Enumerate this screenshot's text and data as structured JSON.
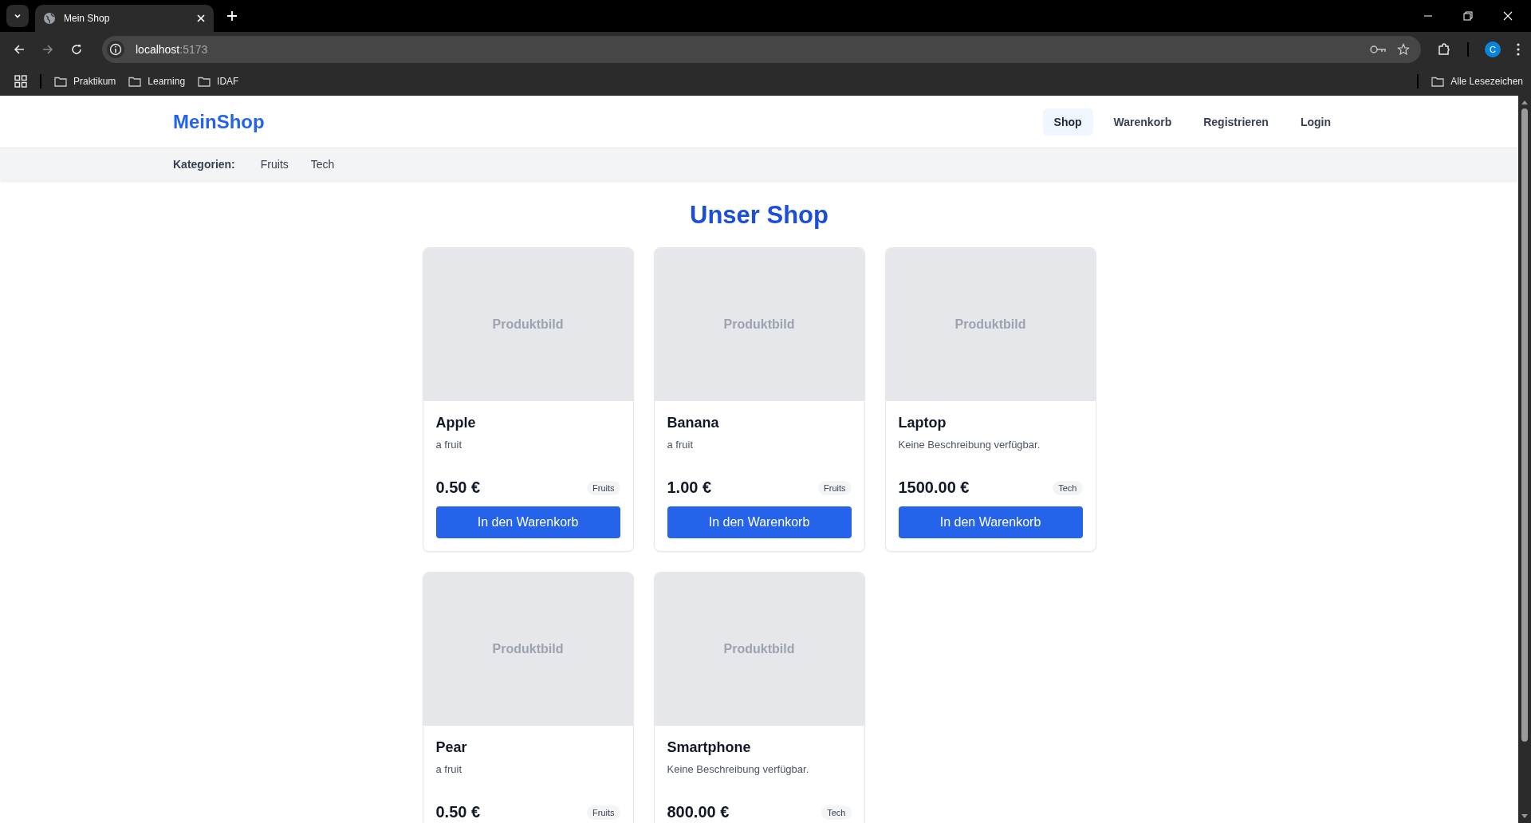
{
  "browser": {
    "tabs": [
      {
        "title": "Mein Shop",
        "selected": true
      }
    ],
    "address": {
      "host": "localhost",
      "port": ":5173"
    },
    "bookmarks": [
      "Praktikum",
      "Learning",
      "IDAF"
    ],
    "all_bookmarks": "Alle Lesezeichen",
    "profile_initial": "C"
  },
  "header": {
    "logo": "MeinShop",
    "nav": [
      {
        "label": "Shop",
        "selected": true
      },
      {
        "label": "Warenkorb",
        "selected": false
      },
      {
        "label": "Registrieren",
        "selected": false
      },
      {
        "label": "Login",
        "selected": false
      }
    ]
  },
  "categories": {
    "label": "Kategorien:",
    "items": [
      "Fruits",
      "Tech"
    ]
  },
  "heading": "Unser Shop",
  "products": [
    {
      "image_placeholder": "Produktbild",
      "name": "Apple",
      "description": "a fruit",
      "price": "0.50 €",
      "category": "Fruits",
      "button": "In den Warenkorb"
    },
    {
      "image_placeholder": "Produktbild",
      "name": "Banana",
      "description": "a fruit",
      "price": "1.00 €",
      "category": "Fruits",
      "button": "In den Warenkorb"
    },
    {
      "image_placeholder": "Produktbild",
      "name": "Laptop",
      "description": "Keine Beschreibung verfügbar.",
      "price": "1500.00 €",
      "category": "Tech",
      "button": "In den Warenkorb"
    },
    {
      "image_placeholder": "Produktbild",
      "name": "Pear",
      "description": "a fruit",
      "price": "0.50 €",
      "category": "Fruits"
    },
    {
      "image_placeholder": "Produktbild",
      "name": "Smartphone",
      "description": "Keine Beschreibung verfügbar.",
      "price": "800.00 €",
      "category": "Tech"
    }
  ]
}
